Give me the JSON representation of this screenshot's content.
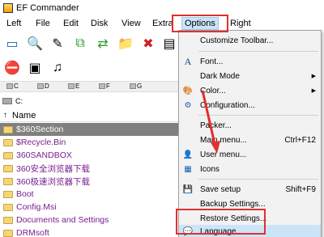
{
  "window": {
    "title": "EF Commander"
  },
  "menubar": {
    "left": "Left",
    "file": "File",
    "edit": "Edit",
    "disk": "Disk",
    "view": "View",
    "extras": "Extra",
    "options": "Options",
    "right": "Right"
  },
  "drives": [
    "C",
    "D",
    "E",
    "F",
    "G"
  ],
  "path": "C:",
  "list": {
    "header": "Name",
    "items": [
      "$360Section",
      "$Recycle.Bin",
      "360SANDBOX",
      "360安全浏览器下载",
      "360极速浏览器下载",
      "Boot",
      "Config.Msi",
      "Documents and Settings",
      "DRMsoft"
    ]
  },
  "options_menu": {
    "customize_toolbar": "Customize Toolbar...",
    "font": "Font...",
    "dark_mode": "Dark Mode",
    "color": "Color...",
    "configuration": "Configuration...",
    "packer": "Packer...",
    "main_menu": "Main menu...",
    "main_menu_key": "Ctrl+F12",
    "user_menu": "User menu...",
    "icons": "Icons",
    "save_setup": "Save setup",
    "save_setup_key": "Shift+F9",
    "backup_settings": "Backup Settings...",
    "restore_settings": "Restore Settings...",
    "language": "Language..."
  },
  "colors": {
    "highlight": "#e03030",
    "selected_row": "#808080",
    "menu_bg": "#f2f2f2"
  }
}
